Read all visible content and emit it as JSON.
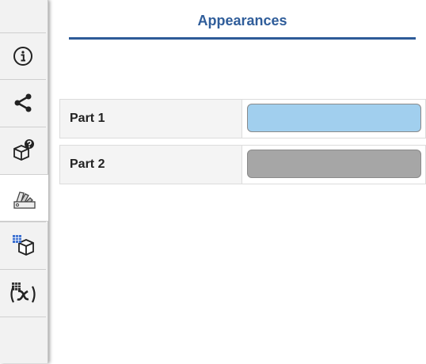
{
  "panel": {
    "title": "Appearances"
  },
  "tabs": [
    {
      "name": "info-icon"
    },
    {
      "name": "share-icon"
    },
    {
      "name": "part-question-icon"
    },
    {
      "name": "appearance-palette-icon"
    },
    {
      "name": "table-cube-icon"
    },
    {
      "name": "function-icon"
    }
  ],
  "parts": [
    {
      "label": "Part 1",
      "color": "#a1cfee"
    },
    {
      "label": "Part 2",
      "color": "#a6a6a6"
    }
  ]
}
